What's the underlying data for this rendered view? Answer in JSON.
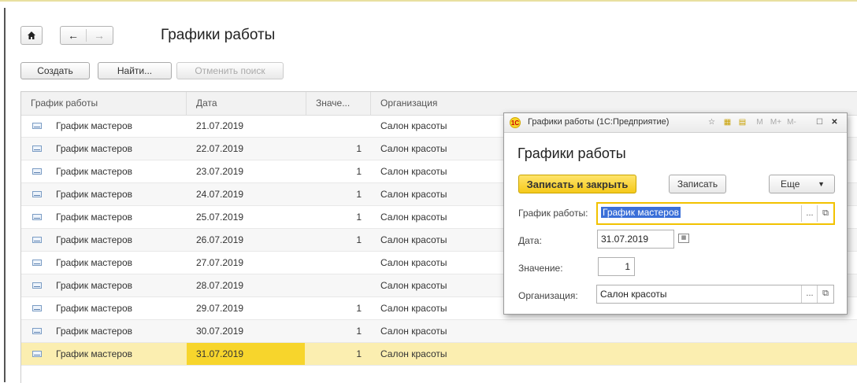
{
  "nav": {
    "home_icon": "home-icon",
    "back_icon": "←",
    "forward_icon": "→"
  },
  "page_title": "Графики работы",
  "toolbar": {
    "create": "Создать",
    "find": "Найти...",
    "cancel_search": "Отменить поиск"
  },
  "table": {
    "columns": [
      "График работы",
      "Дата",
      "Значе...",
      "Организация"
    ],
    "rows": [
      {
        "schedule": "График мастеров",
        "date": "21.07.2019",
        "value": "",
        "org": "Салон красоты"
      },
      {
        "schedule": "График мастеров",
        "date": "22.07.2019",
        "value": "1",
        "org": "Салон красоты"
      },
      {
        "schedule": "График мастеров",
        "date": "23.07.2019",
        "value": "1",
        "org": "Салон красоты"
      },
      {
        "schedule": "График мастеров",
        "date": "24.07.2019",
        "value": "1",
        "org": "Салон красоты"
      },
      {
        "schedule": "График мастеров",
        "date": "25.07.2019",
        "value": "1",
        "org": "Салон красоты"
      },
      {
        "schedule": "График мастеров",
        "date": "26.07.2019",
        "value": "1",
        "org": "Салон красоты"
      },
      {
        "schedule": "График мастеров",
        "date": "27.07.2019",
        "value": "",
        "org": "Салон красоты"
      },
      {
        "schedule": "График мастеров",
        "date": "28.07.2019",
        "value": "",
        "org": "Салон красоты"
      },
      {
        "schedule": "График мастеров",
        "date": "29.07.2019",
        "value": "1",
        "org": "Салон красоты"
      },
      {
        "schedule": "График мастеров",
        "date": "30.07.2019",
        "value": "1",
        "org": "Салон красоты"
      },
      {
        "schedule": "График мастеров",
        "date": "31.07.2019",
        "value": "1",
        "org": "Салон красоты"
      }
    ],
    "selected_index": 10
  },
  "dialog": {
    "window_title": "Графики работы (1С:Предприятие)",
    "logo_text": "1С",
    "titlebar_buttons": [
      "M",
      "M+",
      "M-"
    ],
    "heading": "Графики работы",
    "save_close": "Записать и закрыть",
    "save": "Записать",
    "more": "Еще",
    "fields": {
      "schedule_label": "График работы:",
      "schedule_value": "График мастеров",
      "date_label": "Дата:",
      "date_value": "31.07.2019",
      "value_label": "Значение:",
      "value_value": "1",
      "org_label": "Организация:",
      "org_value": "Салон красоты"
    }
  },
  "colors": {
    "accent": "#f7d52c",
    "selected_row": "#fbeeb0",
    "selection_blue": "#3a6fd8"
  }
}
